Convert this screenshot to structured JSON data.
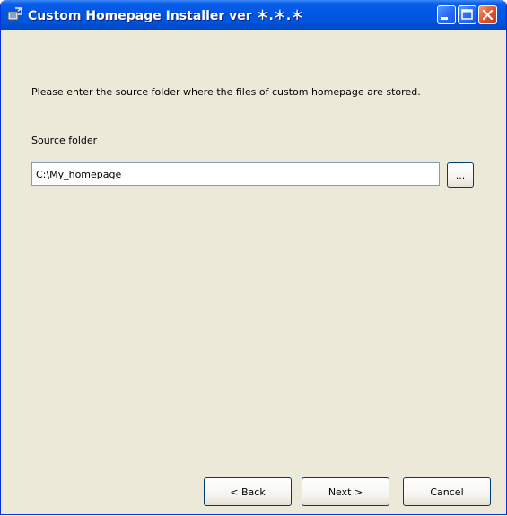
{
  "window": {
    "title": "Custom Homepage Installer  ver ＊.＊.＊"
  },
  "content": {
    "prompt": "Please enter the source folder where the files of custom homepage are stored.",
    "source_label": "Source folder",
    "source_value": "C:\\My_homepage",
    "browse_label": "..."
  },
  "footer": {
    "back_label": "< Back",
    "next_label": "Next >",
    "cancel_label": "Cancel"
  },
  "colors": {
    "titlebar": "#0058e6",
    "dialog_bg": "#ece9d8",
    "close_button": "#e2562d"
  },
  "icons": [
    "installer-app-icon",
    "minimize-icon",
    "maximize-icon",
    "close-icon"
  ]
}
